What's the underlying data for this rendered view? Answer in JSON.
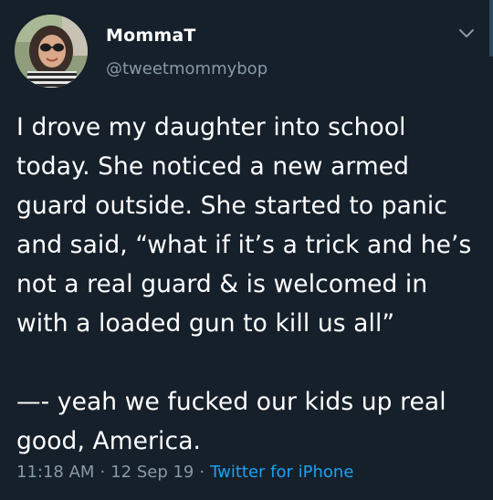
{
  "user": {
    "display_name": "MommaT",
    "handle": "@tweetmommybop",
    "avatar_icon": "profile-photo"
  },
  "tweet": {
    "paragraphs": [
      "I drove my daughter into school today. She noticed a new armed guard outside. She started to panic and said, “what if it’s a trick and he’s not a real guard & is welcomed in with a loaded gun to kill us all”",
      "—- yeah we fucked our kids up real good, America."
    ],
    "time": "11:18 AM",
    "separator": "·",
    "date": "12 Sep 19",
    "source": "Twitter for iPhone"
  },
  "colors": {
    "background": "#15202b",
    "text": "#ffffff",
    "secondary_text": "#8899a6",
    "link": "#1da1f2"
  },
  "icons": {
    "menu": "chevron-down-icon"
  }
}
